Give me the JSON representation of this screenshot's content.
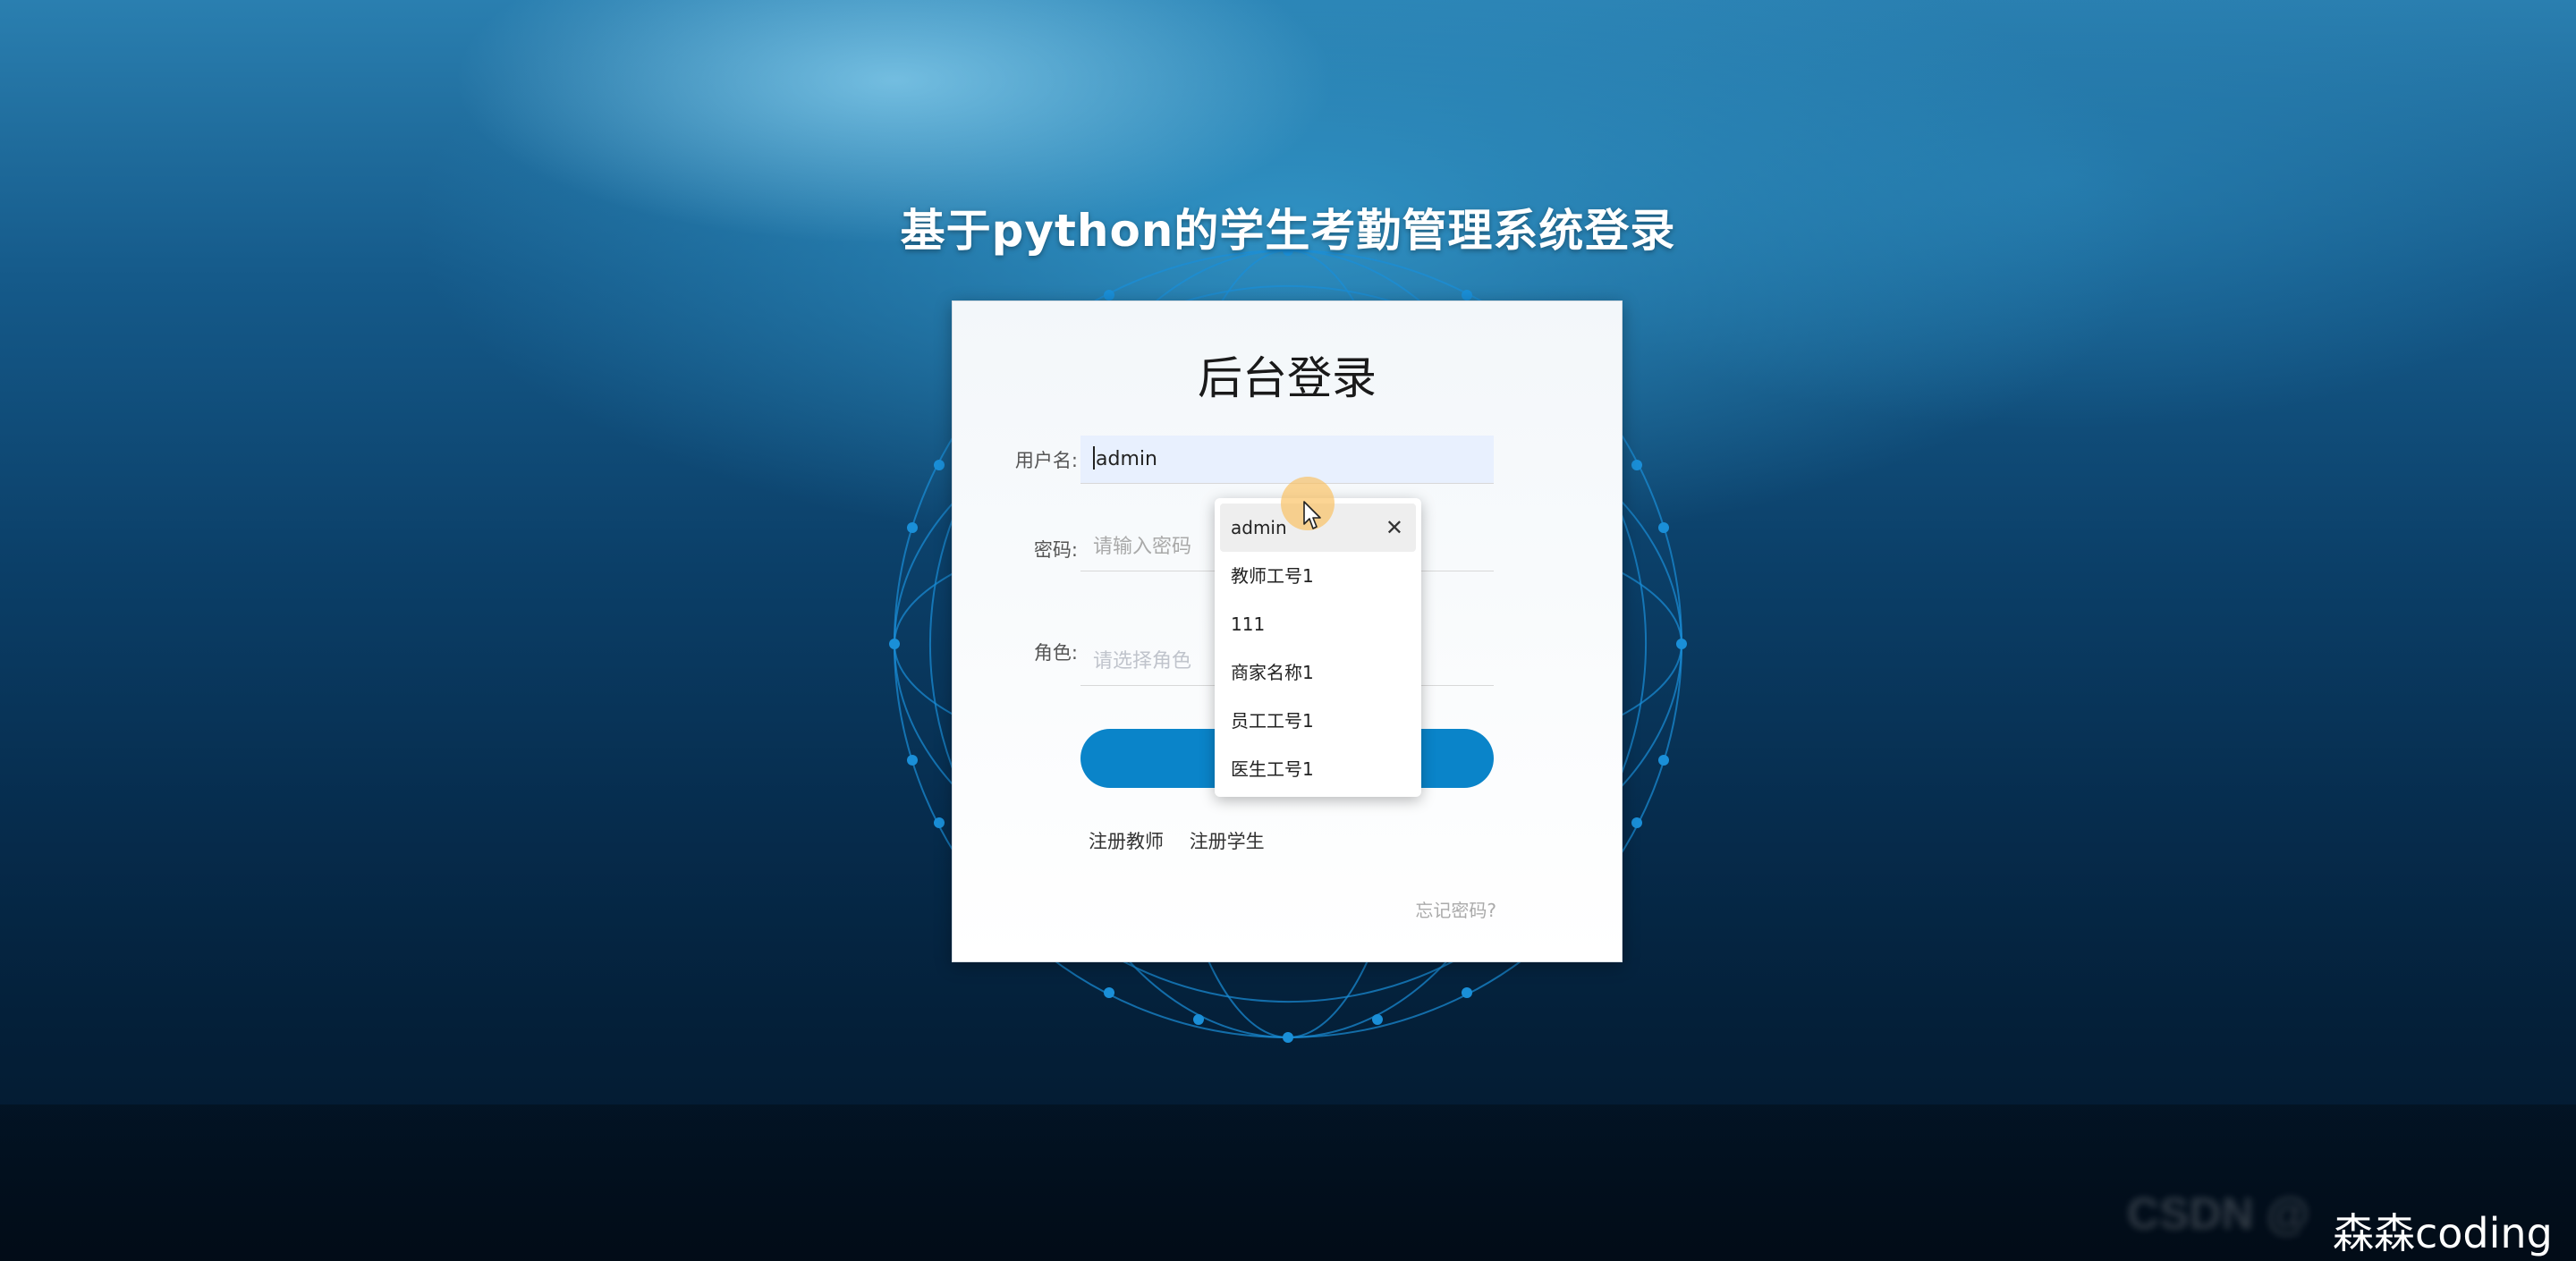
{
  "page": {
    "title": "基于python的学生考勤管理系统登录"
  },
  "login": {
    "heading": "后台登录",
    "username_label": "用户名:",
    "username_value": "admin",
    "password_label": "密码:",
    "password_placeholder": "请输入密码",
    "role_label": "角色:",
    "role_placeholder": "请选择角色",
    "register_teacher": "注册教师",
    "register_student": "注册学生",
    "forgot_password": "忘记密码?"
  },
  "autocomplete": {
    "items": [
      "admin",
      "教师工号1",
      "111",
      "商家名称1",
      "员工工号1",
      "医生工号1"
    ],
    "remove_symbol": "✕"
  },
  "watermark": {
    "text": "森森coding",
    "faded_text": "CSDN @"
  },
  "colors": {
    "button": "#0a84c9",
    "autofill_bg": "#e8f0fe",
    "sphere_line": "#1a8fd8"
  }
}
